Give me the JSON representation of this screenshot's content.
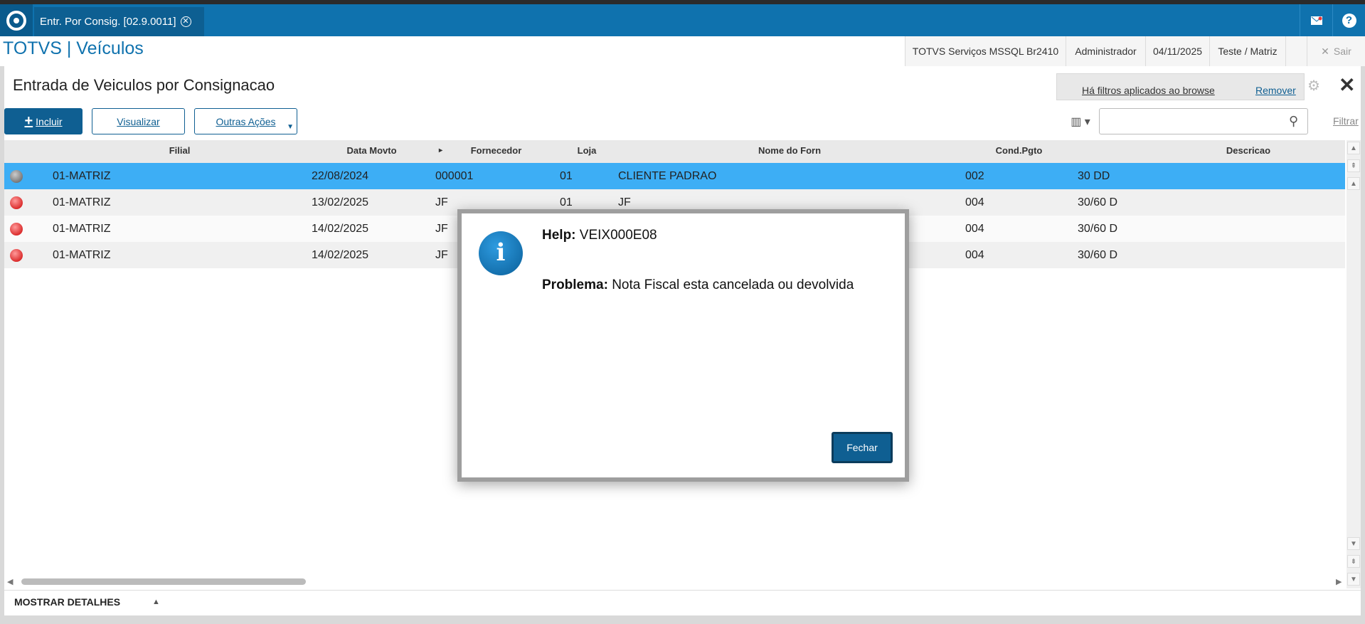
{
  "tab": {
    "label": "Entr. Por Consig. [02.9.0011]",
    "close": "✕"
  },
  "header": {
    "app_title": "TOTVS | Veículos",
    "environment": "TOTVS Serviços MSSQL Br2410",
    "user": "Administrador",
    "date": "04/11/2025",
    "company": "Teste / Matriz",
    "logout": "Sair",
    "logout_icon": "✕"
  },
  "page": {
    "title": "Entrada de Veiculos por Consignacao",
    "filter_notice": "Há filtros aplicados ao browse",
    "filter_remove": "Remover",
    "gear": "⚙",
    "close": "✕"
  },
  "toolbar": {
    "incluir_icon": "+",
    "incluir": "Incluir",
    "visualizar": "Visualizar",
    "outras": "Outras Ações",
    "outras_caret": "▼",
    "columns_icon": "▥ ▾",
    "search_placeholder": "",
    "search_icon": "⚲",
    "filtrar": "Filtrar"
  },
  "grid": {
    "headers": {
      "filial": "Filial",
      "data": "Data Movto",
      "sort": "▸",
      "fornecedor": "Fornecedor",
      "loja": "Loja",
      "nome": "Nome do Forn",
      "cond": "Cond.Pgto",
      "descricao": "Descricao"
    },
    "rows": [
      {
        "status": "gray",
        "filial": "01-MATRIZ",
        "data": "22/08/2024",
        "fornecedor": "000001",
        "loja": "01",
        "nome": "CLIENTE PADRAO",
        "cond": "002",
        "descricao": "30 DD"
      },
      {
        "status": "red",
        "filial": "01-MATRIZ",
        "data": "13/02/2025",
        "fornecedor": "JF",
        "loja": "01",
        "nome": "JF",
        "cond": "004",
        "descricao": "30/60 D"
      },
      {
        "status": "red",
        "filial": "01-MATRIZ",
        "data": "14/02/2025",
        "fornecedor": "JF",
        "loja": "",
        "nome": "",
        "cond": "004",
        "descricao": "30/60 D"
      },
      {
        "status": "red",
        "filial": "01-MATRIZ",
        "data": "14/02/2025",
        "fornecedor": "JF",
        "loja": "",
        "nome": "",
        "cond": "004",
        "descricao": "30/60 D"
      }
    ]
  },
  "scroll": {
    "up_top": "▲",
    "up_page": "⇞",
    "up": "▲",
    "down": "▼",
    "down_page": "⇟",
    "down_bottom": "▼",
    "left": "◀",
    "right": "▶"
  },
  "footer": {
    "detalhes": "MOSTRAR DETALHES",
    "detalhes_arrow": "▲"
  },
  "dialog": {
    "icon": "i",
    "help_label": "Help:",
    "help_code": " VEIX000E08",
    "problem_label": "Problema:",
    "problem_text": " Nota Fiscal esta cancelada ou devolvida",
    "close_button": "Fechar"
  },
  "colors": {
    "brand": "#0f72ae",
    "selected_row": "#3daef5",
    "button": "#0f5f92"
  }
}
